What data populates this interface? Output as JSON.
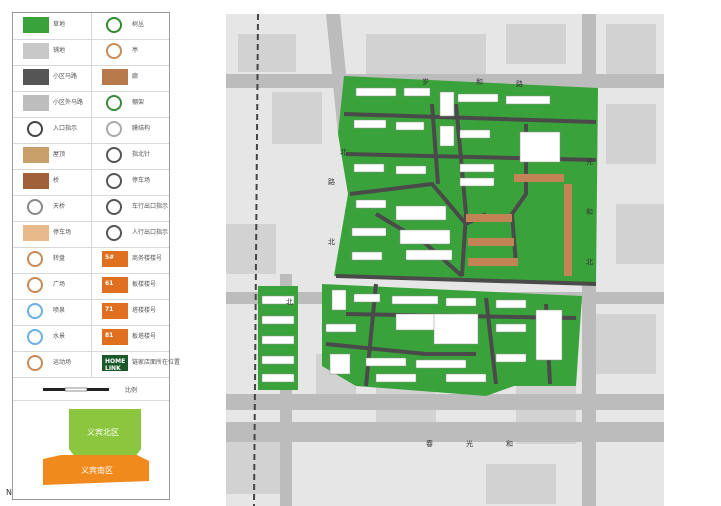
{
  "legend": {
    "items": [
      {
        "label": "草地",
        "swatch": "grass",
        "color": "#3aa23a"
      },
      {
        "label": "树丛",
        "swatch": "shrub-icon",
        "color": "#2e8b2e"
      },
      {
        "label": "铺地",
        "swatch": "paving",
        "color": "#c8c8c8"
      },
      {
        "label": "亭",
        "swatch": "pavilion-icon",
        "color": "#c98a55"
      },
      {
        "label": "小区马路",
        "swatch": "road",
        "color": "#555555"
      },
      {
        "label": "廊",
        "swatch": "corridor",
        "color": "#b87a4a"
      },
      {
        "label": "小区外马路",
        "swatch": "outer-road",
        "color": "#bdbdbd"
      },
      {
        "label": "棚架",
        "swatch": "trellis-icon",
        "color": "#3a8a3a"
      },
      {
        "label": "入口指示",
        "swatch": "entrance-icon",
        "color": "#444444"
      },
      {
        "label": "膜结构",
        "swatch": "membrane-icon",
        "color": "#aaaaaa"
      },
      {
        "label": "屋顶",
        "swatch": "roof",
        "color": "#c9a06a"
      },
      {
        "label": "指北针",
        "swatch": "north-arrow-icon",
        "color": "#555555"
      },
      {
        "label": "桥",
        "swatch": "bridge",
        "color": "#a0613a"
      },
      {
        "label": "停车场",
        "swatch": "parking-icon",
        "color": "#555555"
      },
      {
        "label": "天桥",
        "swatch": "skywalk-icon",
        "color": "#888888"
      },
      {
        "label": "车行出口指示",
        "swatch": "car-exit-icon",
        "color": "#555555"
      },
      {
        "label": "停车场",
        "swatch": "parking-lot",
        "color": "#e8b98a"
      },
      {
        "label": "人行出口指示",
        "swatch": "pedestrian-exit-icon",
        "color": "#555555"
      },
      {
        "label": "转盘",
        "swatch": "roundabout-icon",
        "color": "#c98a55"
      },
      {
        "label": "商务楼楼号",
        "swatch": "business-building-badge",
        "color": "#e07020",
        "badge": "5#"
      },
      {
        "label": "广场",
        "swatch": "plaza-icon",
        "color": "#c98a55"
      },
      {
        "label": "板楼楼号",
        "swatch": "slab-building-badge",
        "color": "#e07020",
        "badge": "61"
      },
      {
        "label": "喷泉",
        "swatch": "fountain-icon",
        "color": "#6ab0e0"
      },
      {
        "label": "塔楼楼号",
        "swatch": "tower-building-badge",
        "color": "#e07020",
        "badge": "71"
      },
      {
        "label": "水景",
        "swatch": "water-icon",
        "color": "#6ab0e0"
      },
      {
        "label": "板塔楼号",
        "swatch": "slab-tower-badge",
        "color": "#e07020",
        "badge": "81"
      },
      {
        "label": "运动场",
        "swatch": "sports-field-icon",
        "color": "#c98a55"
      },
      {
        "label": "链家店面所在位置",
        "swatch": "homelink-store",
        "color": "#1a5a2a",
        "badge": "HOME LINK"
      }
    ],
    "scale_label": "比例",
    "north_label": "N"
  },
  "mini_map": {
    "north_area": {
      "label": "义宾北区",
      "color": "#8cc63f"
    },
    "south_area": {
      "label": "义宾南区",
      "color": "#f08a1c"
    }
  },
  "map": {
    "road_labels": [
      "岁",
      "和",
      "路",
      "北",
      "光",
      "和",
      "北",
      "路",
      "北",
      "春",
      "光",
      "和",
      "北"
    ],
    "colors": {
      "green": "#3aa23a",
      "dark_green": "#1f7a2a",
      "road": "#4a4a4a",
      "building": "#ffffff",
      "roof": "#c28454",
      "outer": "#e6e6e6",
      "block": "#d4d4d4"
    }
  }
}
